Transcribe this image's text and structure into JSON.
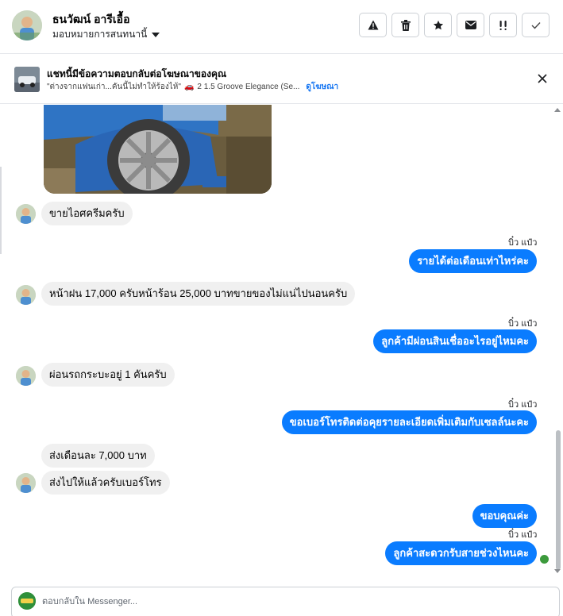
{
  "header": {
    "contact_name": "ธนวัฒน์ อารีเอื้อ",
    "assign_label": "มอบหมายการสนทนานี้",
    "actions": [
      {
        "name": "report-spam-button",
        "icon": "warning-icon"
      },
      {
        "name": "delete-button",
        "icon": "trash-icon"
      },
      {
        "name": "star-button",
        "icon": "star-icon"
      },
      {
        "name": "mark-unread-button",
        "icon": "mail-icon"
      },
      {
        "name": "follow-up-button",
        "icon": "priority-icon"
      },
      {
        "name": "mark-done-button",
        "icon": "check-icon"
      }
    ]
  },
  "ad_banner": {
    "title": "แชทนี้มีข้อความตอบกลับต่อโฆษณาของคุณ",
    "quote": "\"ต่างจากแฟนเก่า...คันนี้ไม่ทำให้ร้องไห้\"",
    "product": "2 1.5 Groove Elegance (Se...",
    "link": "ดูโฆษณา"
  },
  "messages": [
    {
      "dir": "in",
      "text": "ขายไอศครีมครับ"
    },
    {
      "dir": "out",
      "seen": "บิ๋ว แป๋ว",
      "text": "รายได้ต่อเดือนเท่าไหร่คะ"
    },
    {
      "dir": "in",
      "text": "หน้าฝน 17,000 ครับหน้าร้อน 25,000 บาทขายของไม่แน่ไปนอนครับ"
    },
    {
      "dir": "out",
      "seen": "บิ๋ว แป๋ว",
      "text": "ลูกค้ามีผ่อนสินเชื่ออะไรอยู่ไหมคะ"
    },
    {
      "dir": "in",
      "text": "ผ่อนรถกระบะอยู่ 1 คันครับ"
    },
    {
      "dir": "out",
      "seen": "บิ๋ว แป๋ว",
      "text": "ขอเบอร์โทรติดต่อคุยรายละเอียดเพิ่มเติมกับเซลล์นะคะ"
    },
    {
      "dir": "in",
      "text": "ส่งเดือนละ 7,000 บาท"
    },
    {
      "dir": "in",
      "text": "ส่งไปให้แล้วครับเบอร์โทร"
    },
    {
      "dir": "out",
      "text": "ขอบคุณค่ะ"
    },
    {
      "dir": "out",
      "seen": "บิ๋ว แป๋ว",
      "text": "ลูกค้าสะดวกรับสายช่วงไหนคะ"
    }
  ],
  "composer": {
    "placeholder": "ตอบกลับใน Messenger..."
  },
  "colors": {
    "outgoing_bubble": "#0a7cff",
    "incoming_bubble": "#f0f0f0",
    "link": "#1877f2"
  }
}
